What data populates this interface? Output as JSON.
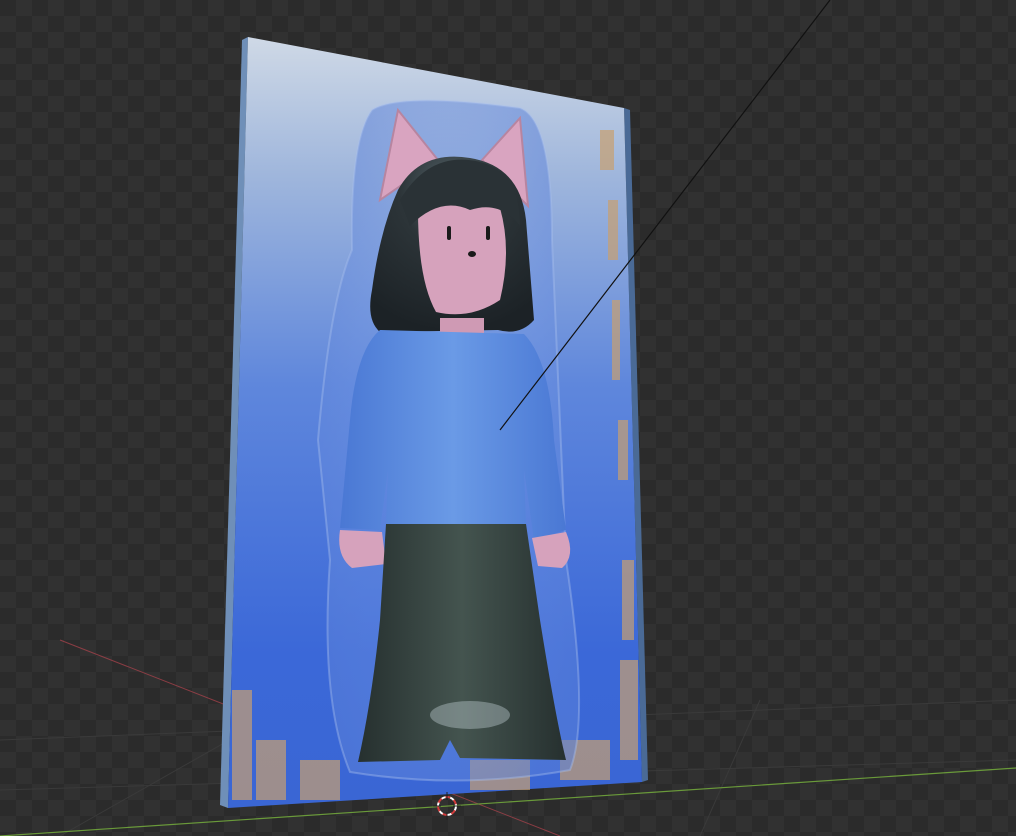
{
  "viewport": {
    "view": "3d-viewport-rendered",
    "background_pattern": "checker-transparent",
    "colors": {
      "background_dark": "#2b2b2b",
      "background_light": "#313131",
      "x_axis": "#b4454e",
      "y_axis": "#6a9a3a",
      "card_blue": "#3c6ad6",
      "card_top": "#c6d2e2",
      "hair": "#2a3136",
      "skin_pink": "#d9a4c0",
      "shirt_blue": "#5a8ce0",
      "pants": "#3a4a48",
      "speckle_gold": "#c8a070"
    }
  },
  "objects": {
    "figure_card": {
      "description_name": "blister-card"
    },
    "figure": {
      "description_name": "cat-ear-figurine"
    },
    "camera_line": {
      "description_name": "light-direction-line"
    },
    "cursor_3d": {
      "description_name": "3d-cursor-icon"
    }
  }
}
